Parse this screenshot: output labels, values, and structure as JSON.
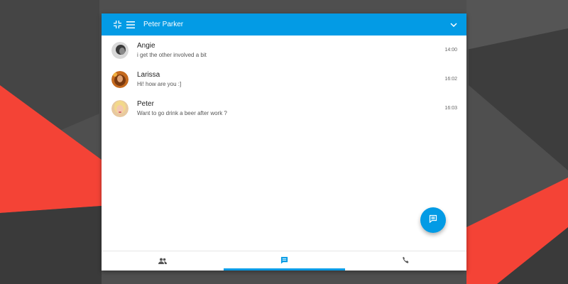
{
  "header": {
    "title": "Peter Parker"
  },
  "conversations": [
    {
      "name": "Angie",
      "message": "i get the other involved a bit",
      "time": "14:00"
    },
    {
      "name": "Larissa",
      "message": "Hi! how are you :]",
      "time": "16:02"
    },
    {
      "name": "Peter",
      "message": "Want to go drink a beer after work ?",
      "time": "16:03"
    }
  ],
  "icons": {
    "collapse": "collapse-icon",
    "menu": "menu-icon",
    "dropdown": "chevron-down-icon",
    "fab": "new-message-icon",
    "tab_contacts": "people-icon",
    "tab_messages": "chat-icon",
    "tab_calls": "phone-icon"
  },
  "navigation": {
    "tabs": [
      "contacts",
      "messages",
      "calls"
    ],
    "active_tab": "messages"
  },
  "colors": {
    "accent": "#039be5",
    "background": "#4a4a4a",
    "red_stripe": "#f44336"
  }
}
